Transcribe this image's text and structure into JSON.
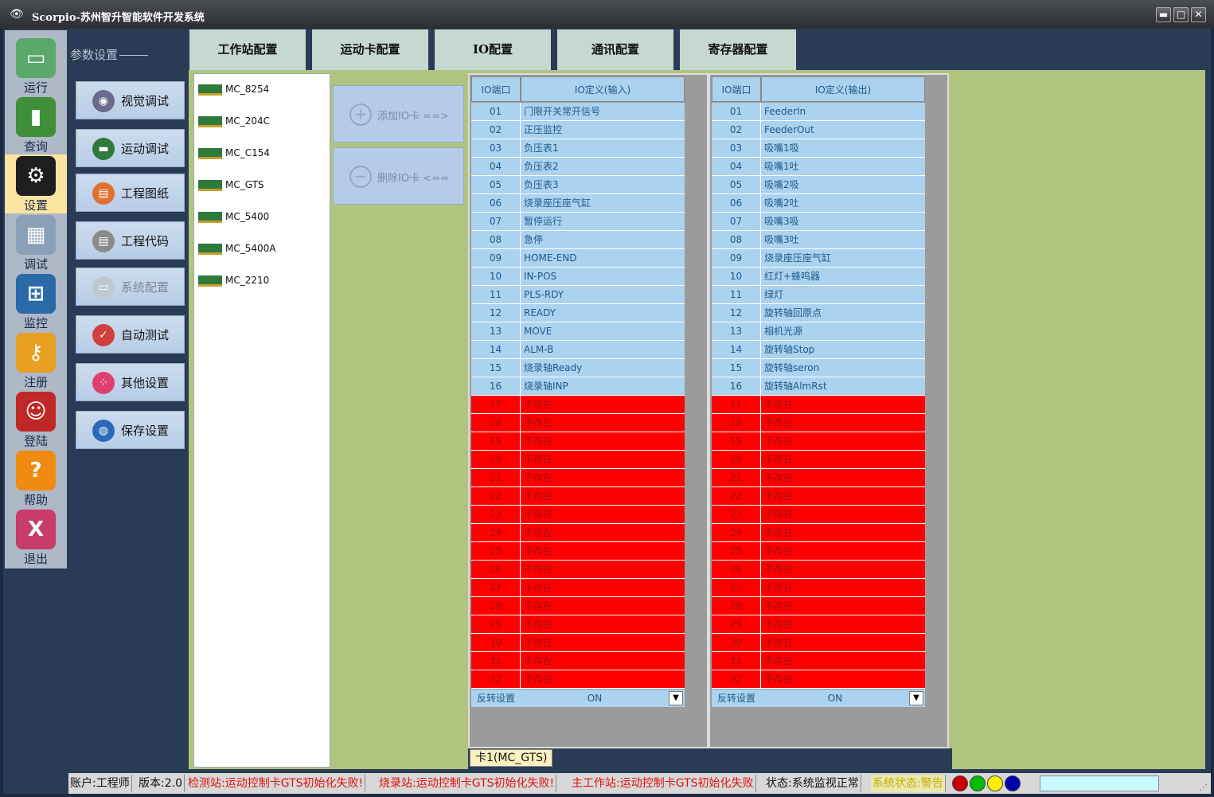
{
  "app": {
    "logo_glyph": "👁",
    "title": "Scorpio-苏州智升智能软件开发系统",
    "min": "▬",
    "max": "□",
    "close": "✕"
  },
  "nav": {
    "items": [
      {
        "label": "运行",
        "icon": "monitor-icon",
        "glyph": "▭",
        "color": "#5aa86a"
      },
      {
        "label": "查询",
        "icon": "bar-chart-icon",
        "glyph": "▮",
        "color": "#3f8f3a"
      },
      {
        "label": "设置",
        "icon": "gear-icon",
        "glyph": "⚙",
        "color": "#1e1e1e"
      },
      {
        "label": "调试",
        "icon": "spreadsheet-icon",
        "glyph": "▦",
        "color": "#8aa0b8"
      },
      {
        "label": "监控",
        "icon": "windows-screen-icon",
        "glyph": "⊞",
        "color": "#2a6aa8"
      },
      {
        "label": "注册",
        "icon": "key-icon",
        "glyph": "⚷",
        "color": "#e8a020"
      },
      {
        "label": "登陆",
        "icon": "user-card-icon",
        "glyph": "☺",
        "color": "#c02828"
      },
      {
        "label": "帮助",
        "icon": "question-icon",
        "glyph": "?",
        "color": "#f08a10"
      },
      {
        "label": "退出",
        "icon": "exit-icon",
        "glyph": "X",
        "color": "#c83c6a"
      }
    ]
  },
  "param": {
    "title": "参数设置",
    "buttons": [
      {
        "label": "视觉调试",
        "icon": "camera-icon",
        "glyph": "◉",
        "color": "#6a6a8a"
      },
      {
        "label": "运动调试",
        "icon": "motion-card-icon",
        "glyph": "▬",
        "color": "#2f7a3b"
      },
      {
        "label": "工程图纸",
        "icon": "dxf-file-icon",
        "glyph": "▤",
        "color": "#e07030"
      },
      {
        "label": "工程代码",
        "icon": "code-file-icon",
        "glyph": "▤",
        "color": "#8a8a8a"
      },
      {
        "label": "系统配置",
        "icon": "computer-icon",
        "glyph": "▭",
        "color": "#c0c8d0"
      },
      {
        "label": "自动测试",
        "icon": "checklist-icon",
        "glyph": "✓",
        "color": "#d04040"
      },
      {
        "label": "其他设置",
        "icon": "apps-icon",
        "glyph": "⁘",
        "color": "#e04070"
      },
      {
        "label": "保存设置",
        "icon": "save-globe-icon",
        "glyph": "◍",
        "color": "#2a6ab8"
      }
    ]
  },
  "tabs": [
    "工作站配置",
    "运动卡配置",
    "IO配置",
    "通讯配置",
    "寄存器配置"
  ],
  "cards": [
    "MC_8254",
    "MC_204C",
    "MC_C154",
    "MC_GTS",
    "MC_5400",
    "MC_5400A",
    "MC_2210"
  ],
  "io_buttons": {
    "add": "添加IO卡 ==>",
    "del": "删除IO卡 <=="
  },
  "input_table": {
    "headers": [
      "IO端口",
      "IO定义(输入)"
    ],
    "rows": [
      [
        "01",
        "门限开关常开信号"
      ],
      [
        "02",
        "正压监控"
      ],
      [
        "03",
        "负压表1"
      ],
      [
        "04",
        "负压表2"
      ],
      [
        "05",
        "负压表3"
      ],
      [
        "06",
        "烧录座压座气缸"
      ],
      [
        "07",
        "暂停运行"
      ],
      [
        "08",
        "急停"
      ],
      [
        "09",
        "HOME-END"
      ],
      [
        "10",
        "IN-POS"
      ],
      [
        "11",
        "PLS-RDY"
      ],
      [
        "12",
        "READY"
      ],
      [
        "13",
        "MOVE"
      ],
      [
        "14",
        "ALM-B"
      ],
      [
        "15",
        "烧录轴Ready"
      ],
      [
        "16",
        "烧录轴INP"
      ],
      [
        "17",
        "不存在"
      ],
      [
        "18",
        "不存在"
      ],
      [
        "19",
        "不存在"
      ],
      [
        "20",
        "不存在"
      ],
      [
        "21",
        "不存在"
      ],
      [
        "22",
        "不存在"
      ],
      [
        "23",
        "不存在"
      ],
      [
        "24",
        "不存在"
      ],
      [
        "25",
        "不存在"
      ],
      [
        "26",
        "不存在"
      ],
      [
        "27",
        "不存在"
      ],
      [
        "28",
        "不存在"
      ],
      [
        "29",
        "不存在"
      ],
      [
        "30",
        "不存在"
      ],
      [
        "31",
        "不存在"
      ],
      [
        "32",
        "不存在"
      ]
    ],
    "reverse_label": "反转设置",
    "reverse_value": "ON",
    "dropdown_glyph": "▼"
  },
  "output_table": {
    "headers": [
      "IO端口",
      "IO定义(输出)"
    ],
    "rows": [
      [
        "01",
        "FeederIn"
      ],
      [
        "02",
        "FeederOut"
      ],
      [
        "03",
        "吸嘴1吸"
      ],
      [
        "04",
        "吸嘴1吐"
      ],
      [
        "05",
        "吸嘴2吸"
      ],
      [
        "06",
        "吸嘴2吐"
      ],
      [
        "07",
        "吸嘴3吸"
      ],
      [
        "08",
        "吸嘴3吐"
      ],
      [
        "09",
        "烧录座压座气缸"
      ],
      [
        "10",
        "红灯+蜂鸣器"
      ],
      [
        "11",
        "绿灯"
      ],
      [
        "12",
        "旋转轴回原点"
      ],
      [
        "13",
        "相机光源"
      ],
      [
        "14",
        "旋转轴Stop"
      ],
      [
        "15",
        "旋转轴seron"
      ],
      [
        "16",
        "旋转轴AlmRst"
      ],
      [
        "17",
        "不存在"
      ],
      [
        "18",
        "不存在"
      ],
      [
        "19",
        "不存在"
      ],
      [
        "20",
        "不存在"
      ],
      [
        "21",
        "不存在"
      ],
      [
        "22",
        "不存在"
      ],
      [
        "23",
        "不存在"
      ],
      [
        "24",
        "不存在"
      ],
      [
        "25",
        "不存在"
      ],
      [
        "26",
        "不存在"
      ],
      [
        "27",
        "不存在"
      ],
      [
        "28",
        "不存在"
      ],
      [
        "29",
        "不存在"
      ],
      [
        "30",
        "不存在"
      ],
      [
        "31",
        "不存在"
      ],
      [
        "32",
        "不存在"
      ]
    ],
    "reverse_label": "反转设置",
    "reverse_value": "ON",
    "dropdown_glyph": "▼"
  },
  "card_tab": "卡1(MC_GTS)",
  "status": {
    "account": "账户:工程师",
    "version": "版本:2.0",
    "err1": "检测站:运动控制卡GTS初始化失败!",
    "err2": "烧录站:运动控制卡GTS初始化失败!",
    "err3": "主工作站:运动控制卡GTS初始化失败",
    "monitor": "状态:系统监视正常",
    "system": "系统状态:警告",
    "lights": [
      "#cc0000",
      "#00bb00",
      "#ffee00",
      "#0000aa"
    ],
    "grip": "⋰"
  }
}
